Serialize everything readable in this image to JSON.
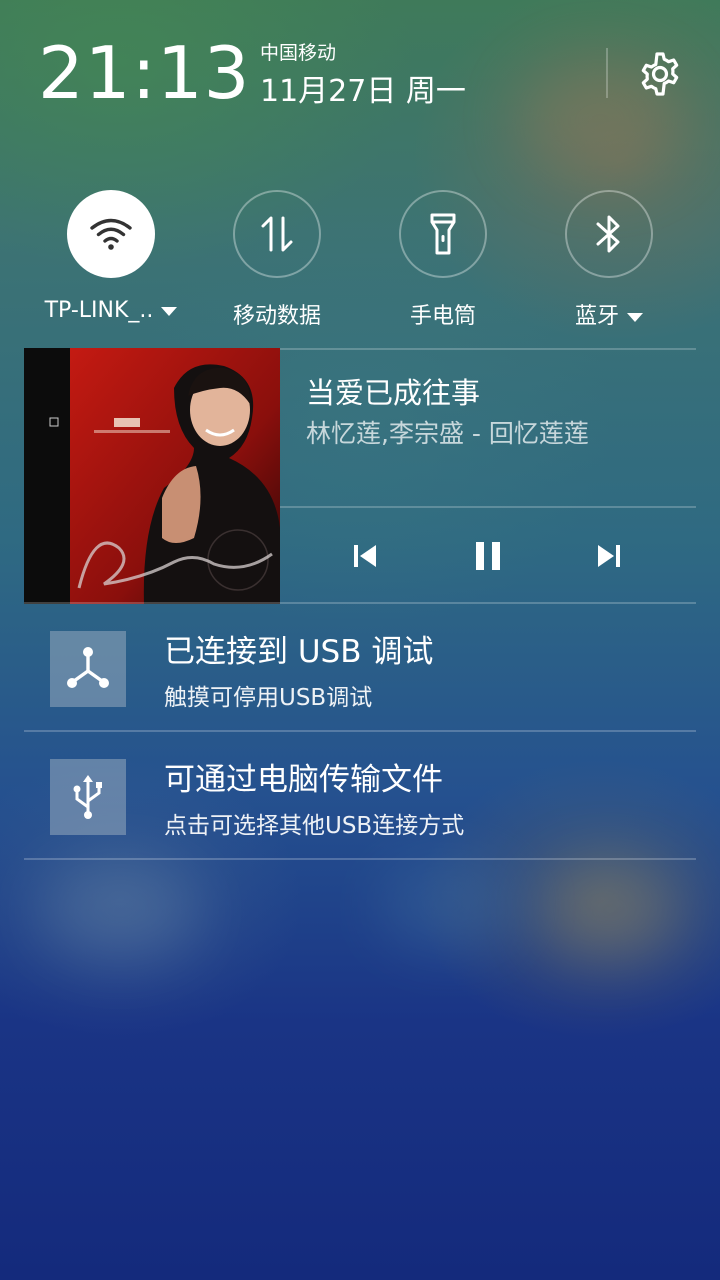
{
  "status": {
    "time": "21:13",
    "carrier": "中国移动",
    "date": "11月27日 周一"
  },
  "quick_settings": [
    {
      "label": "TP-LINK_..",
      "icon": "wifi-icon",
      "active": true,
      "has_dropdown": true
    },
    {
      "label": "移动数据",
      "icon": "mobile-data-icon",
      "active": false,
      "has_dropdown": false
    },
    {
      "label": "手电筒",
      "icon": "flashlight-icon",
      "active": false,
      "has_dropdown": false
    },
    {
      "label": "蓝牙",
      "icon": "bluetooth-icon",
      "active": false,
      "has_dropdown": true
    }
  ],
  "media": {
    "title": "当爱已成往事",
    "subtitle": "林忆莲,李宗盛 - 回忆莲莲",
    "controls": [
      "previous-icon",
      "pause-icon",
      "next-icon"
    ]
  },
  "notifications": [
    {
      "title": "已连接到 USB 调试",
      "subtitle": "触摸可停用USB调试",
      "icon": "usb-debug-icon"
    },
    {
      "title": "可通过电脑传输文件",
      "subtitle": "点击可选择其他USB连接方式",
      "icon": "usb-icon"
    }
  ],
  "colors": {
    "background_top": "#3f7a5a",
    "background_bottom": "#142a7c",
    "active_tile": "#ffffff",
    "notif_icon_bg": "#8da0b4"
  }
}
